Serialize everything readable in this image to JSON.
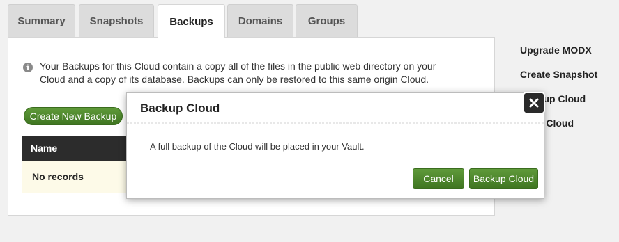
{
  "tabs": [
    {
      "label": "Summary",
      "active": false
    },
    {
      "label": "Snapshots",
      "active": false
    },
    {
      "label": "Backups",
      "active": true
    },
    {
      "label": "Domains",
      "active": false
    },
    {
      "label": "Groups",
      "active": false
    }
  ],
  "info": {
    "icon": "info-icon",
    "text": "Your Backups for this Cloud contain a copy all of the files in the public web directory on your Cloud and a copy of its database. Backups can only be restored to this same origin Cloud."
  },
  "create_button": "Create New Backup",
  "table": {
    "header": "Name",
    "empty_text": "No records"
  },
  "sidebar": {
    "links": [
      "Upgrade MODX",
      "Create Snapshot",
      "Backup Cloud",
      "Vault Cloud"
    ]
  },
  "modal": {
    "title": "Backup Cloud",
    "message": "A full backup of the Cloud will be placed in your Vault.",
    "cancel_label": "Cancel",
    "confirm_label": "Backup Cloud",
    "close_icon": "close-icon"
  },
  "colors": {
    "accent_green": "#4a8529",
    "table_header": "#2c2c2c",
    "row_highlight": "#fdfae8"
  }
}
